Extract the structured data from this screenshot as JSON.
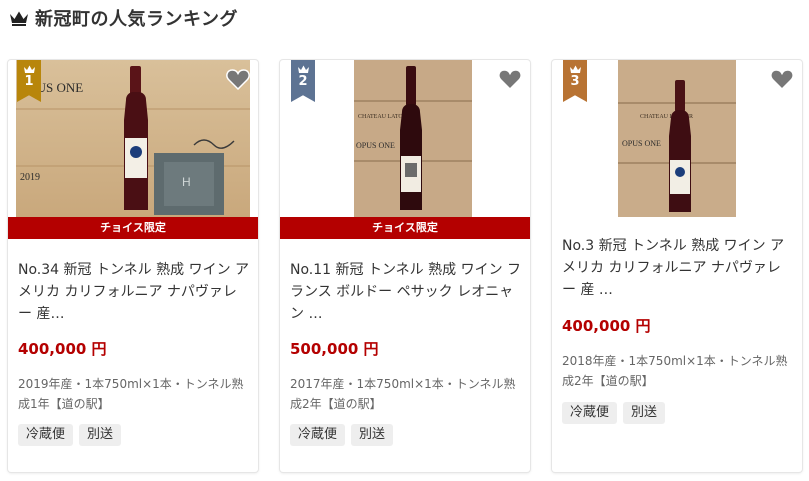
{
  "header": {
    "title": "新冠町の人気ランキング",
    "icon": "crown-icon"
  },
  "colors": {
    "accent": "#b40000",
    "gold": "#b8860b",
    "steel": "#5d7393",
    "bronze": "#b87333"
  },
  "cards": [
    {
      "rank": "1",
      "choice_label": "チョイス限定",
      "title": "No.34 新冠 トンネル 熟成 ワイン アメリカ カリフォルニア ナパヴァレー 産…",
      "price": "400,000 円",
      "desc": "2019年産・1本750ml×1本・トンネル熟成1年【道の駅】",
      "tags": [
        "冷蔵便",
        "別送"
      ],
      "image_text": {
        "label": "OPUS ONE",
        "year": "2019",
        "box_letter": "H"
      }
    },
    {
      "rank": "2",
      "choice_label": "チョイス限定",
      "title": "No.11 新冠 トンネル 熟成 ワイン フランス ボルドー ペサック レオニャン …",
      "price": "500,000 円",
      "desc": "2017年産・1本750ml×1本・トンネル熟成2年【道の駅】",
      "tags": [
        "冷蔵便",
        "別送"
      ],
      "image_text": {
        "label": "OPUS ONE",
        "crate": "CHATEAU LATOUR"
      }
    },
    {
      "rank": "3",
      "title": "No.3 新冠 トンネル 熟成 ワイン アメリカ カリフォルニア ナパヴァレー 産 …",
      "price": "400,000 円",
      "desc": "2018年産・1本750ml×1本・トンネル熟成2年【道の駅】",
      "tags": [
        "冷蔵便",
        "別送"
      ],
      "image_text": {
        "label": "OPUS ONE",
        "crate": "CHATEAU LATOUR"
      }
    }
  ]
}
